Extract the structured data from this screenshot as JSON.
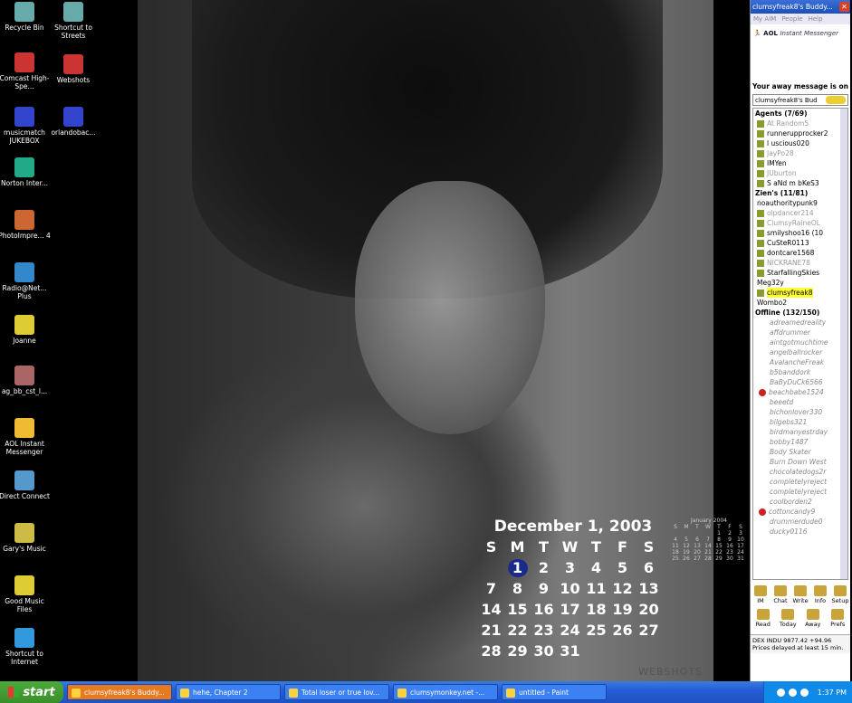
{
  "desktop_icons_col1": [
    {
      "label": "Recycle Bin",
      "icon": "recycle-bin-icon"
    },
    {
      "label": "Comcast High-Spe...",
      "icon": "comcast-icon"
    },
    {
      "label": "musicmatch JUKEBOX",
      "icon": "musicmatch-icon"
    },
    {
      "label": "Norton Inter...",
      "icon": "norton-globe-icon"
    },
    {
      "label": "PhotoImpre... 4",
      "icon": "photoimpression-icon"
    },
    {
      "label": "Radio@Net... Plus",
      "icon": "radio-icon"
    },
    {
      "label": "Joanne",
      "icon": "folder-icon"
    },
    {
      "label": "ag_bb_cst_l...",
      "icon": "image-file-icon"
    },
    {
      "label": "AOL Instant Messenger",
      "icon": "aim-running-man-icon"
    },
    {
      "label": "Direct Connect",
      "icon": "network-icon"
    },
    {
      "label": "Gary's Music",
      "icon": "music-folder-icon"
    },
    {
      "label": "Good Music Files",
      "icon": "folder-icon"
    },
    {
      "label": "Shortcut to Internet",
      "icon": "internet-explorer-icon"
    }
  ],
  "desktop_icons_col2": [
    {
      "label": "Shortcut to Streets",
      "icon": "streets-map-icon"
    },
    {
      "label": "Webshots",
      "icon": "webshots-icon"
    },
    {
      "label": "orlandobac...",
      "icon": "image-file-icon"
    }
  ],
  "calendar": {
    "title": "December 1, 2003",
    "weekdays": [
      "S",
      "M",
      "T",
      "W",
      "T",
      "F",
      "S"
    ],
    "days": [
      "",
      "1",
      "2",
      "3",
      "4",
      "5",
      "6",
      "7",
      "8",
      "9",
      "10",
      "11",
      "12",
      "13",
      "14",
      "15",
      "16",
      "17",
      "18",
      "19",
      "20",
      "21",
      "22",
      "23",
      "24",
      "25",
      "26",
      "27",
      "28",
      "29",
      "30",
      "31",
      "",
      "",
      ""
    ],
    "selected_day": "1"
  },
  "mini_calendar": {
    "title": "January 2004",
    "weekdays": [
      "S",
      "M",
      "T",
      "W",
      "T",
      "F",
      "S"
    ],
    "days": [
      "",
      "",
      "",
      "",
      "1",
      "2",
      "3",
      "4",
      "5",
      "6",
      "7",
      "8",
      "9",
      "10",
      "11",
      "12",
      "13",
      "14",
      "15",
      "16",
      "17",
      "18",
      "19",
      "20",
      "21",
      "22",
      "23",
      "24",
      "25",
      "26",
      "27",
      "28",
      "29",
      "30",
      "31"
    ]
  },
  "wallpaper": {
    "watermark": "WEBSHOTS"
  },
  "aim": {
    "title": "clumsyfreak8's Buddy...",
    "menu": [
      "My AIM",
      "People",
      "Help"
    ],
    "brand": "AOL",
    "brand_sub": "Instant Messenger",
    "away_message": "Your away message is on",
    "selector": "clumsyfreak8's Bud",
    "groups": [
      {
        "name": "Agents (7/69)",
        "buddies": [
          {
            "name": "At Random5",
            "state": "idle"
          },
          {
            "name": "runnerupprocker2",
            "state": "on"
          },
          {
            "name": "l uscious020",
            "state": "on"
          },
          {
            "name": "JayPo28",
            "state": "idle"
          },
          {
            "name": "IMYen",
            "state": "on"
          },
          {
            "name": "JUburton",
            "state": "idle"
          },
          {
            "name": "S aNd m bKeS3",
            "state": "on"
          }
        ]
      },
      {
        "name": "Zien's (11/81)",
        "buddies": [
          {
            "name": "noauthoritypunk9",
            "state": "plain"
          },
          {
            "name": "olpdancer214",
            "state": "idle"
          },
          {
            "name": "ClumsyRaineOL",
            "state": "idle"
          },
          {
            "name": "smilyshoo16 (10",
            "state": "on"
          },
          {
            "name": "CuSteR0113",
            "state": "on"
          },
          {
            "name": "dontcare1568",
            "state": "on"
          },
          {
            "name": "NICKRANE78",
            "state": "idle"
          },
          {
            "name": "StarfallingSkies",
            "state": "on"
          },
          {
            "name": "Meg32y",
            "state": "plain"
          },
          {
            "name": "clumsyfreak8",
            "state": "highlight"
          },
          {
            "name": "Wombo2",
            "state": "plain"
          }
        ]
      },
      {
        "name": "Offline (132/150)",
        "buddies": [
          {
            "name": "adreamedreality",
            "state": "off"
          },
          {
            "name": "affdrummer",
            "state": "off"
          },
          {
            "name": "aintgotmuchtime",
            "state": "off"
          },
          {
            "name": "angelballrocker",
            "state": "off"
          },
          {
            "name": "AvalancheFreak",
            "state": "off"
          },
          {
            "name": "b5banddork",
            "state": "off"
          },
          {
            "name": "BaByDuCk6566",
            "state": "off"
          },
          {
            "name": "beachbabe1524",
            "state": "away"
          },
          {
            "name": "beeetd",
            "state": "off"
          },
          {
            "name": "bichonlover330",
            "state": "off"
          },
          {
            "name": "bilgebs321",
            "state": "off"
          },
          {
            "name": "birdmanyestrday",
            "state": "off"
          },
          {
            "name": "bobby1487",
            "state": "off"
          },
          {
            "name": "Body Skater",
            "state": "off"
          },
          {
            "name": "Burn Down West",
            "state": "off"
          },
          {
            "name": "chocolatedogs2r",
            "state": "off"
          },
          {
            "name": "completelyreject",
            "state": "off"
          },
          {
            "name": "completelyreject",
            "state": "off"
          },
          {
            "name": "coolborden2",
            "state": "off"
          },
          {
            "name": "cottoncandy9",
            "state": "away"
          },
          {
            "name": "drummerdude0",
            "state": "off"
          },
          {
            "name": "ducky0116",
            "state": "off"
          }
        ]
      }
    ],
    "tools": [
      "IM",
      "Chat",
      "Write",
      "Info",
      "Setup",
      "Read",
      "Today",
      "Away",
      "Prefs"
    ],
    "ticker_line1": "DEX INDU 9877.42 +94.96",
    "ticker_line2": "Prices delayed at least 15 min."
  },
  "taskbar": {
    "start_label": "start",
    "tasks": [
      {
        "label": "clumsyfreak8's Buddy...",
        "active": true
      },
      {
        "label": "hehe, Chapter 2",
        "active": false
      },
      {
        "label": "Total loser or true lov...",
        "active": false
      },
      {
        "label": "clumsymonkey.net -...",
        "active": false
      },
      {
        "label": "untitled - Paint",
        "active": false
      }
    ],
    "clock": "1:37 PM"
  }
}
